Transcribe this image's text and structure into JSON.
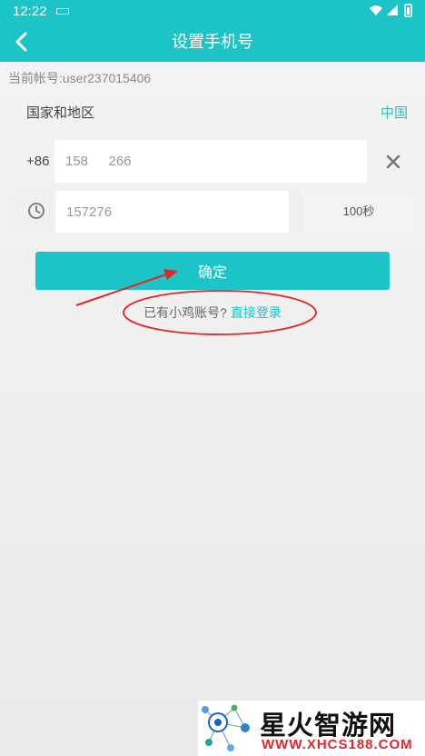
{
  "status_bar": {
    "time": "12:22"
  },
  "app_bar": {
    "title": "设置手机号",
    "back_icon": "back-arrow-icon"
  },
  "account": {
    "text": "当前帐号:user237015406"
  },
  "region": {
    "label": "国家和地区",
    "value": "中国"
  },
  "phone": {
    "country_code": "+86",
    "value": "158   266"
  },
  "otp": {
    "value": "157276",
    "countdown": "100秒"
  },
  "confirm_label": "确定",
  "login_prompt": {
    "text": "已有小鸡账号?",
    "link": "直接登录"
  },
  "watermark": {
    "title": "星火智游网",
    "url": "WWW.XHCS188.COM"
  },
  "colors": {
    "accent": "#1cc4c8",
    "annotation": "#e3262a"
  }
}
